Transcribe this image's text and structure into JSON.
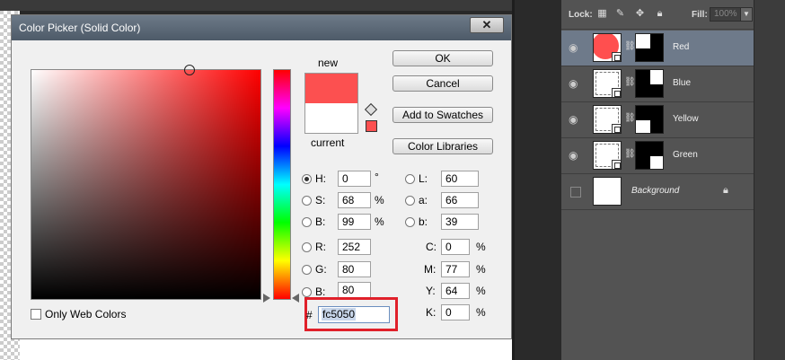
{
  "dialog": {
    "title": "Color Picker (Solid Color)",
    "close_label": "✕",
    "new_label": "new",
    "current_label": "current",
    "new_color": "#fc5050",
    "current_color": "#ffffff",
    "buttons": {
      "ok": "OK",
      "cancel": "Cancel",
      "add_to_swatches": "Add to Swatches",
      "color_libraries": "Color Libraries"
    },
    "hsb": [
      {
        "label": "H:",
        "value": "0",
        "unit": "°",
        "selected": true
      },
      {
        "label": "S:",
        "value": "68",
        "unit": "%",
        "selected": false
      },
      {
        "label": "B:",
        "value": "99",
        "unit": "%",
        "selected": false
      }
    ],
    "rgb": [
      {
        "label": "R:",
        "value": "252"
      },
      {
        "label": "G:",
        "value": "80"
      },
      {
        "label": "B:",
        "value": "80"
      }
    ],
    "lab": [
      {
        "label": "L:",
        "value": "60"
      },
      {
        "label": "a:",
        "value": "66"
      },
      {
        "label": "b:",
        "value": "39"
      }
    ],
    "cmyk": [
      {
        "label": "C:",
        "value": "0",
        "unit": "%"
      },
      {
        "label": "M:",
        "value": "77",
        "unit": "%"
      },
      {
        "label": "Y:",
        "value": "64",
        "unit": "%"
      },
      {
        "label": "K:",
        "value": "0",
        "unit": "%"
      }
    ],
    "hex_label": "#",
    "hex_value": "fc5050",
    "only_web_colors_label": "Only Web Colors"
  },
  "layers_panel": {
    "lock_label": "Lock:",
    "fill_label": "Fill:",
    "fill_value": "100%",
    "layers": [
      {
        "name": "Red",
        "selected": true,
        "visible": true
      },
      {
        "name": "Blue",
        "selected": false,
        "visible": true
      },
      {
        "name": "Yellow",
        "selected": false,
        "visible": true
      },
      {
        "name": "Green",
        "selected": false,
        "visible": true
      },
      {
        "name": "Background",
        "selected": false,
        "visible": false,
        "locked": true
      }
    ]
  }
}
